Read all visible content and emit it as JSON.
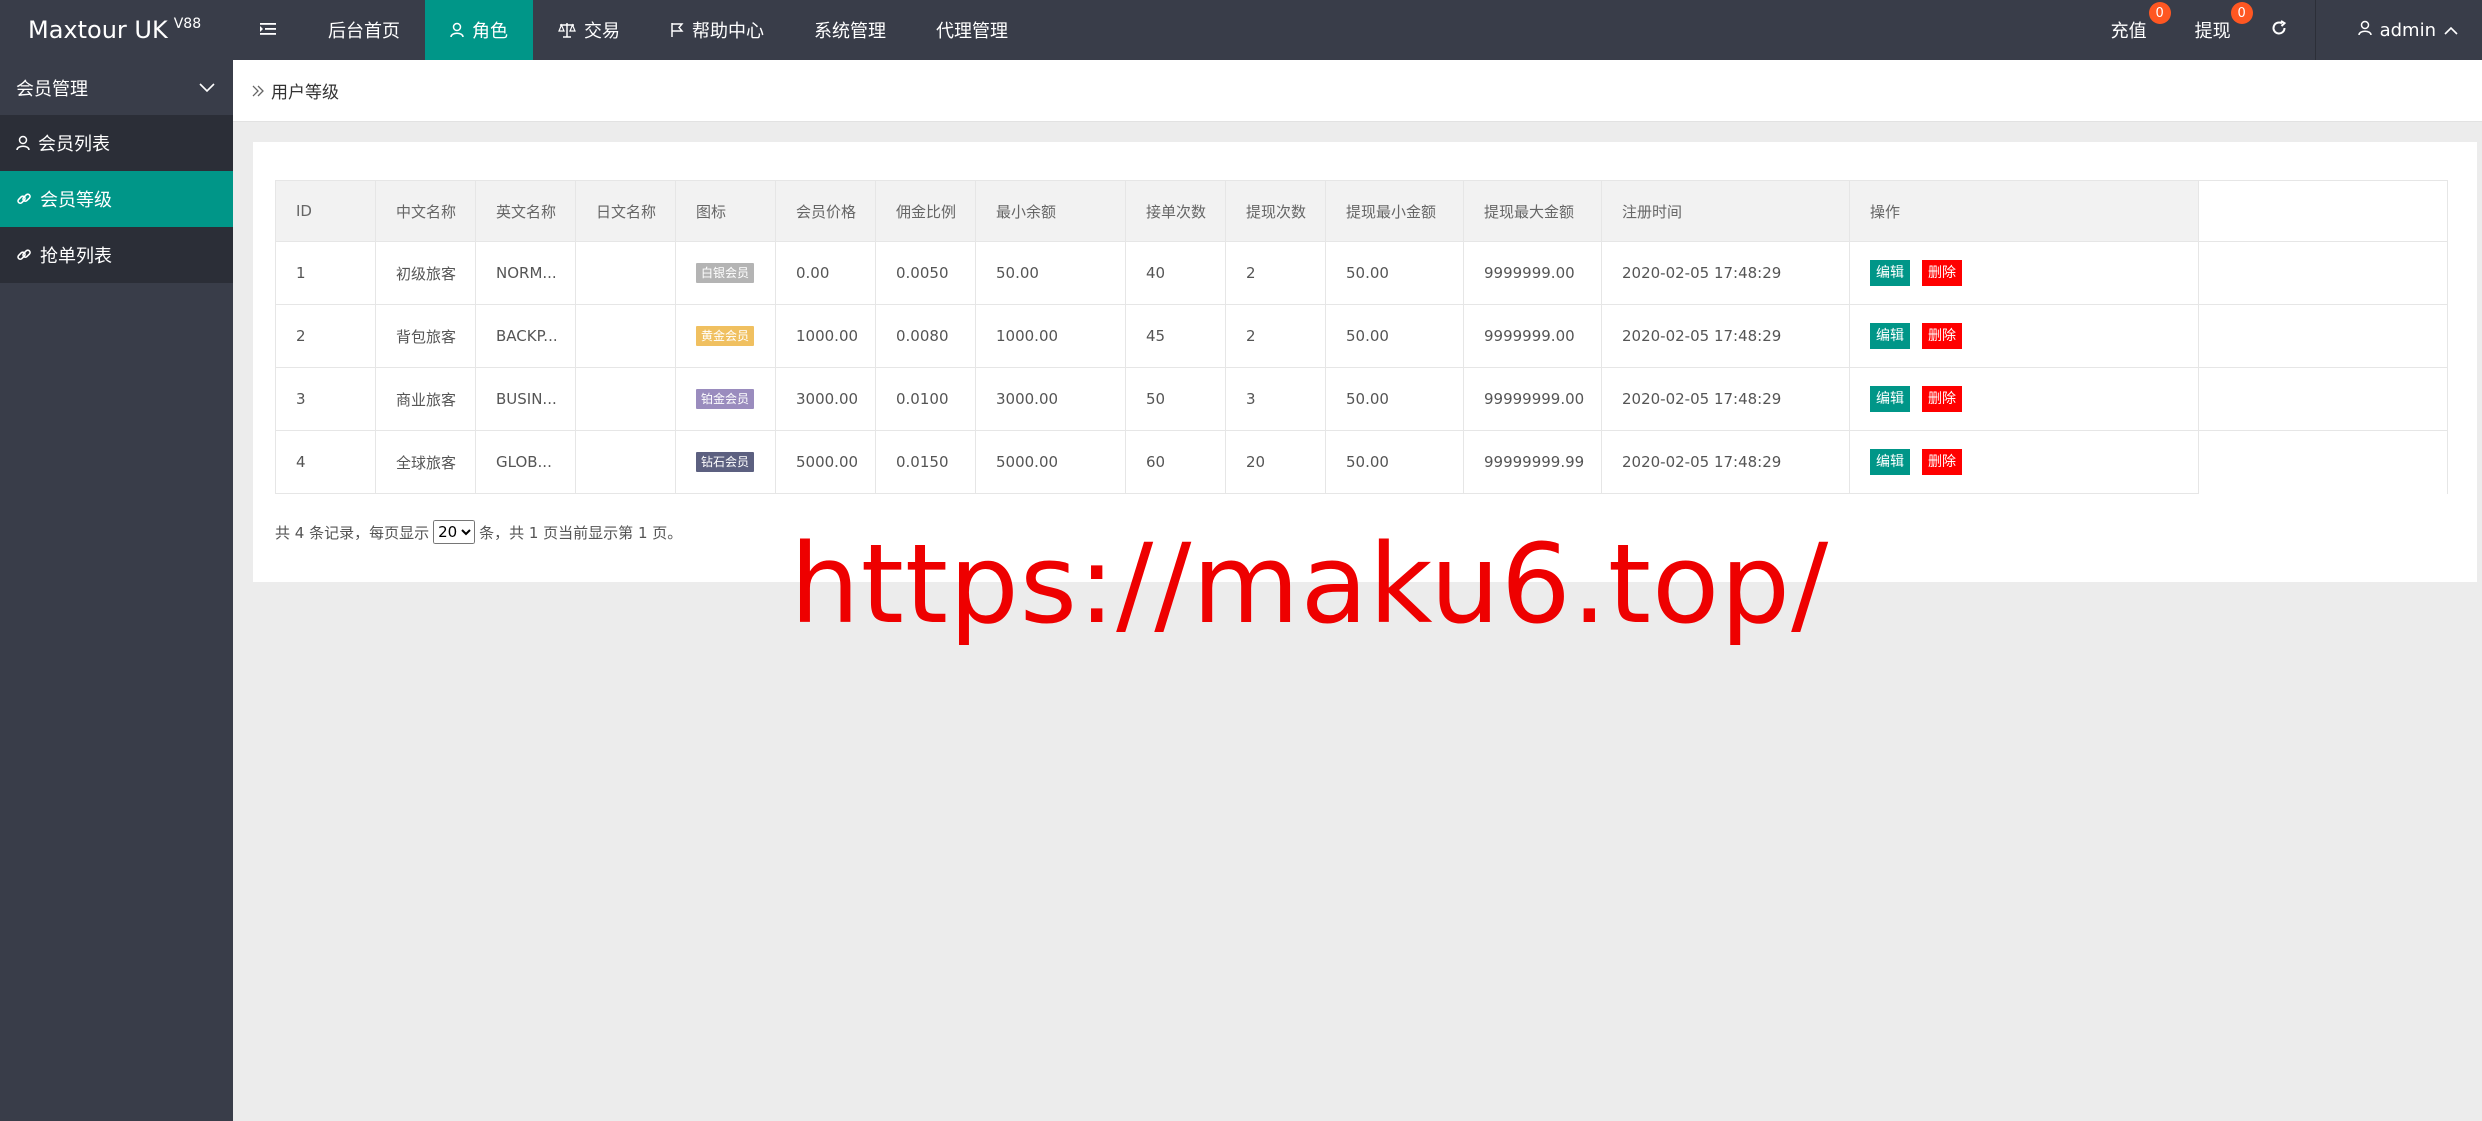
{
  "header": {
    "logo": "Maxtour UK",
    "version": "V88",
    "nav": [
      {
        "label": "后台首页"
      },
      {
        "label": "角色"
      },
      {
        "label": "交易"
      },
      {
        "label": "帮助中心"
      },
      {
        "label": "系统管理"
      },
      {
        "label": "代理管理"
      }
    ],
    "recharge": {
      "label": "充值",
      "count": "0"
    },
    "withdraw": {
      "label": "提现",
      "count": "0"
    },
    "user": "admin"
  },
  "sidebar": {
    "group": "会员管理",
    "items": [
      {
        "label": "会员列表"
      },
      {
        "label": "会员等级"
      },
      {
        "label": "抢单列表"
      }
    ]
  },
  "breadcrumb": "用户等级",
  "table": {
    "columns": [
      "ID",
      "中文名称",
      "英文名称",
      "日文名称",
      "图标",
      "会员价格",
      "佣金比例",
      "最小余额",
      "接单次数",
      "提现次数",
      "提现最小金额",
      "提现最大金额",
      "注册时间",
      "操作"
    ],
    "rows": [
      {
        "id": "1",
        "cn": "初级旅客",
        "en": "NORM...",
        "jp": "",
        "icon": "白银会员",
        "icon_color": "#b4b4b4",
        "price": "0.00",
        "ratio": "0.0050",
        "min_balance": "50.00",
        "orders": "40",
        "withdraw_times": "2",
        "withdraw_min": "50.00",
        "withdraw_max": "9999999.00",
        "time": "2020-02-05 17:48:29"
      },
      {
        "id": "2",
        "cn": "背包旅客",
        "en": "BACKP...",
        "jp": "",
        "icon": "黄金会员",
        "icon_color": "#f0c060",
        "price": "1000.00",
        "ratio": "0.0080",
        "min_balance": "1000.00",
        "orders": "45",
        "withdraw_times": "2",
        "withdraw_min": "50.00",
        "withdraw_max": "9999999.00",
        "time": "2020-02-05 17:48:29"
      },
      {
        "id": "3",
        "cn": "商业旅客",
        "en": "BUSIN...",
        "jp": "",
        "icon": "铂金会员",
        "icon_color": "#9a8cbe",
        "price": "3000.00",
        "ratio": "0.0100",
        "min_balance": "3000.00",
        "orders": "50",
        "withdraw_times": "3",
        "withdraw_min": "50.00",
        "withdraw_max": "99999999.00",
        "time": "2020-02-05 17:48:29"
      },
      {
        "id": "4",
        "cn": "全球旅客",
        "en": "GLOB...",
        "jp": "",
        "icon": "钻石会员",
        "icon_color": "#5c6080",
        "price": "5000.00",
        "ratio": "0.0150",
        "min_balance": "5000.00",
        "orders": "60",
        "withdraw_times": "20",
        "withdraw_min": "50.00",
        "withdraw_max": "99999999.99",
        "time": "2020-02-05 17:48:29"
      }
    ],
    "edit_label": "编辑",
    "delete_label": "删除"
  },
  "pager": {
    "prefix": "共 4 条记录，每页显示",
    "page_size": "20",
    "suffix": "条，共 1 页当前显示第 1 页。"
  },
  "watermark": "https://maku6.top/"
}
